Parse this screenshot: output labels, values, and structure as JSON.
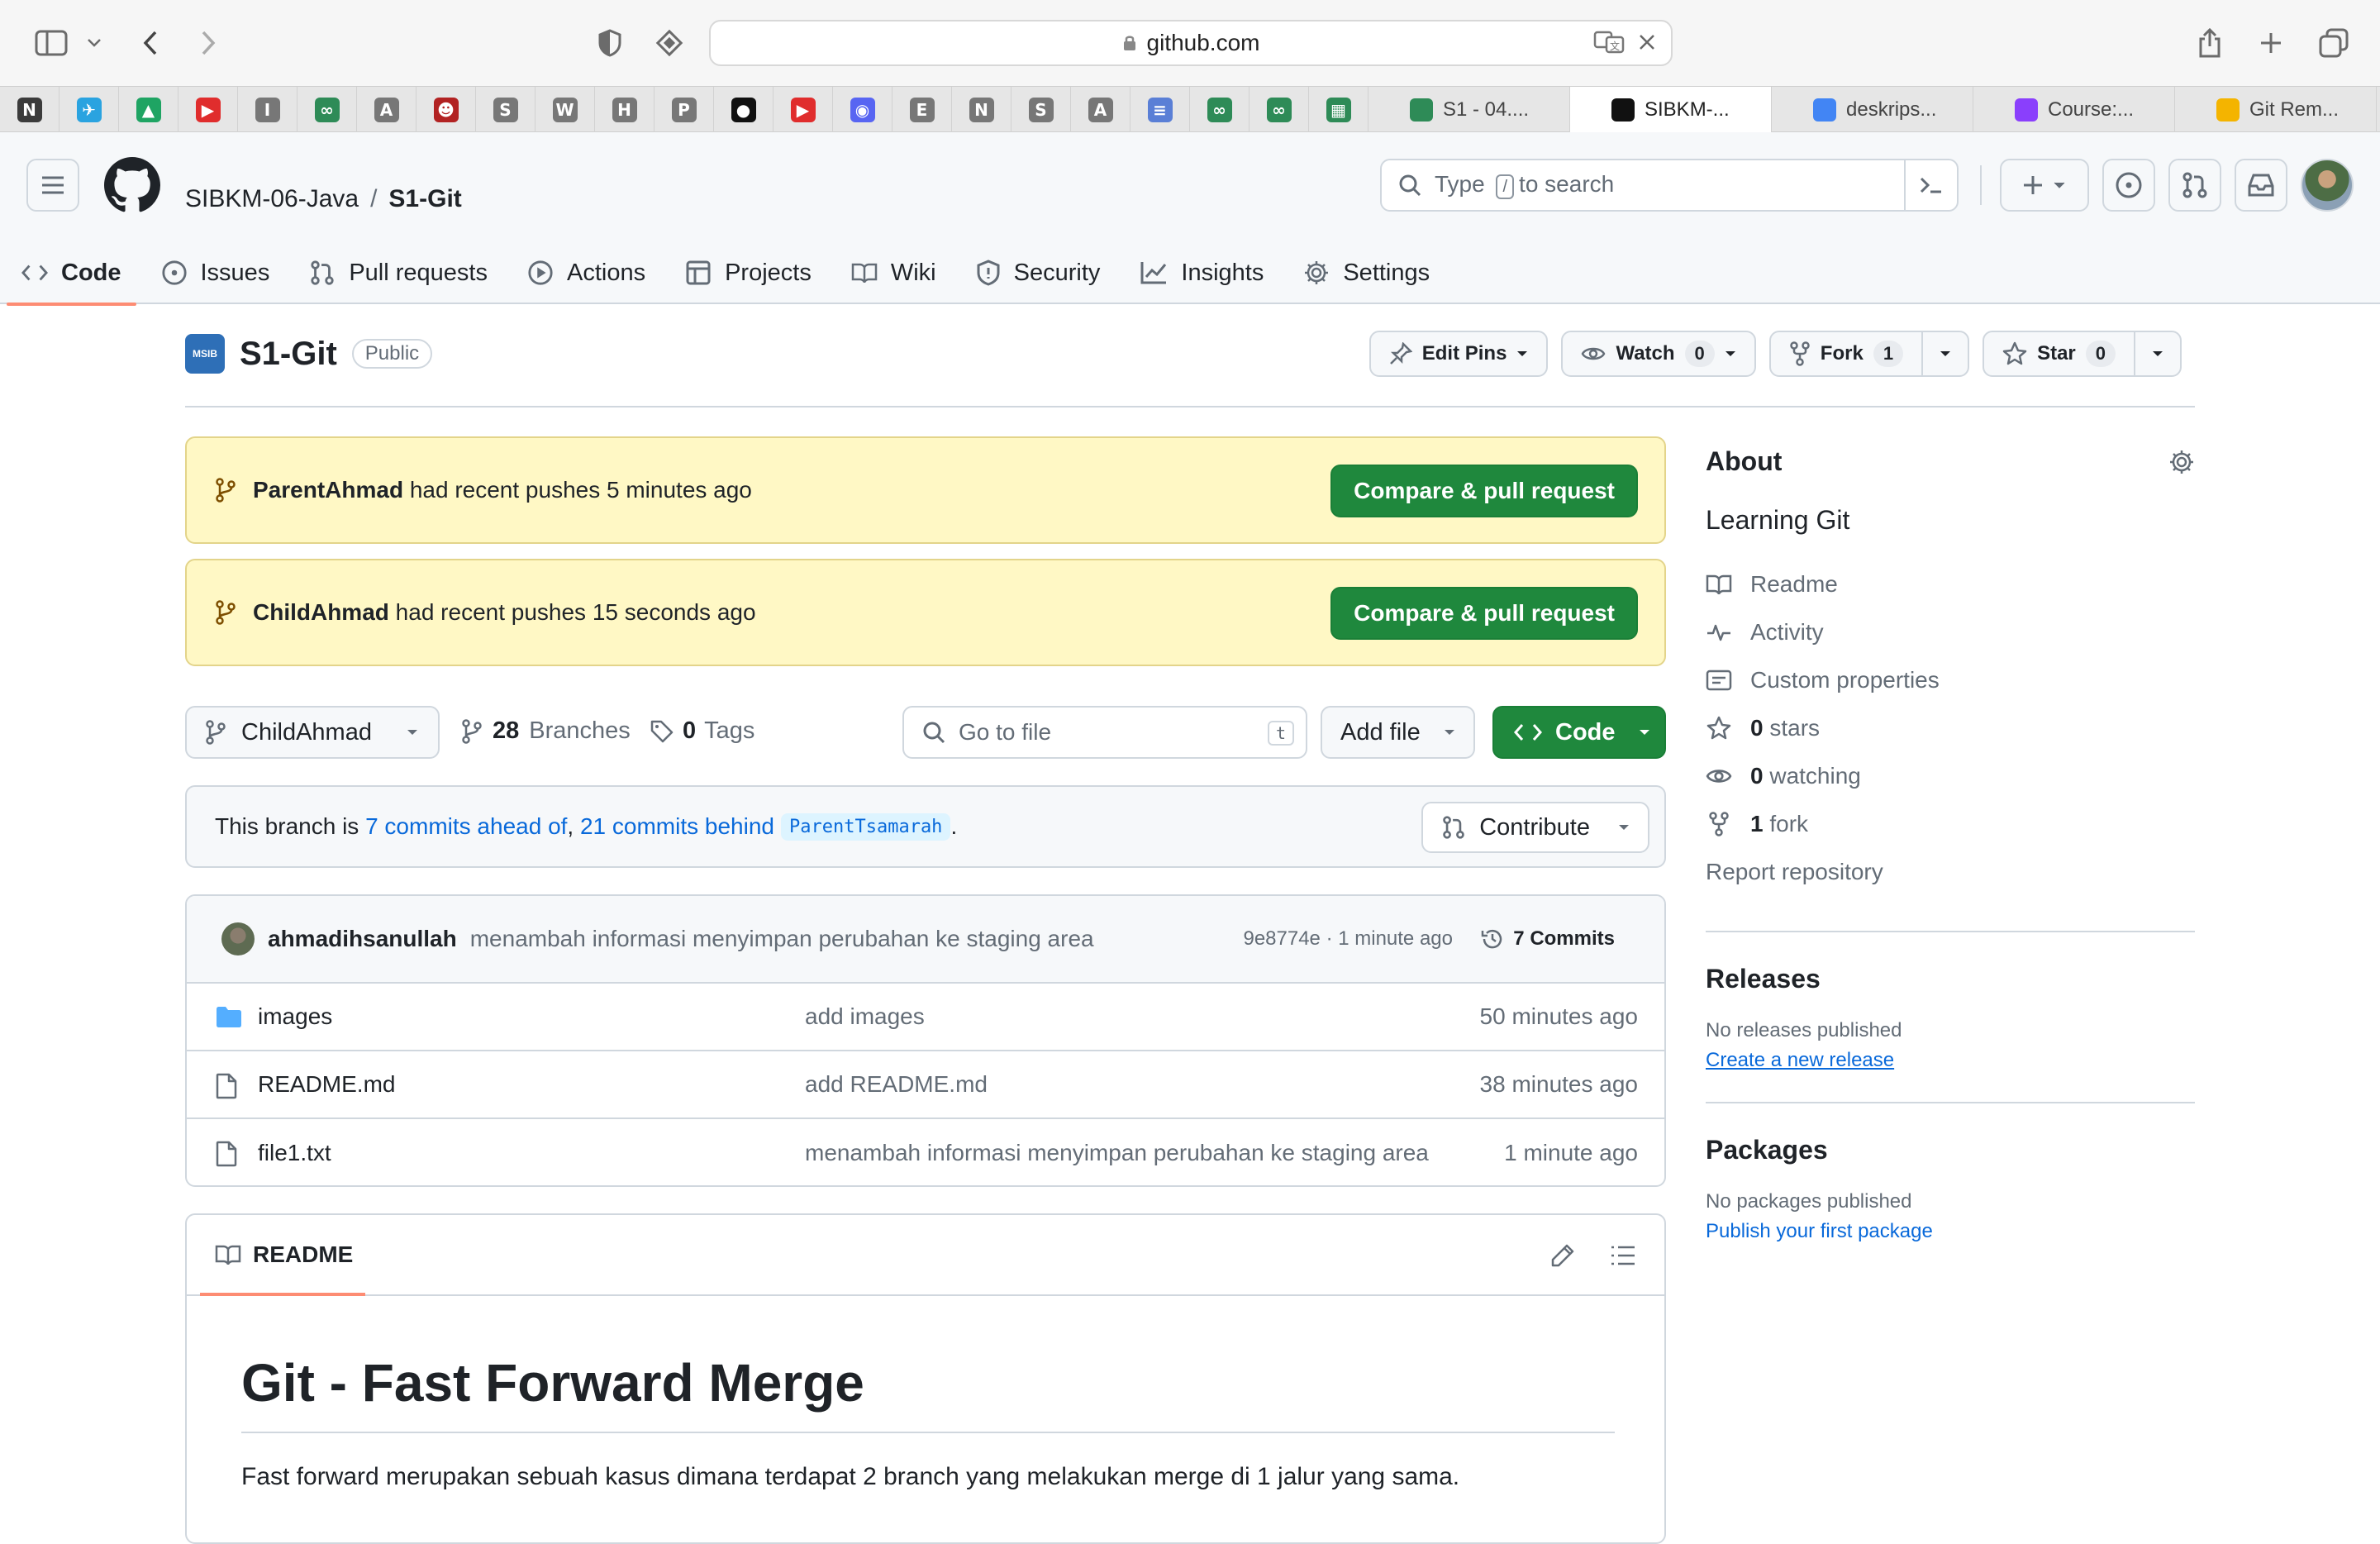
{
  "browser": {
    "url": "github.com",
    "pinned_tabs": [
      {
        "label": "N",
        "color": "#3b3b3b"
      },
      {
        "label": "✈",
        "color": "#2aa3e0"
      },
      {
        "label": "▲",
        "color": "#1fa463"
      },
      {
        "label": "▶",
        "color": "#e02d2d"
      },
      {
        "label": "I",
        "color": "#777777"
      },
      {
        "label": "∞",
        "color": "#2e8b57"
      },
      {
        "label": "A",
        "color": "#777777"
      },
      {
        "label": "☻",
        "color": "#b22222"
      },
      {
        "label": "S",
        "color": "#777777"
      },
      {
        "label": "W",
        "color": "#777777"
      },
      {
        "label": "H",
        "color": "#777777"
      },
      {
        "label": "P",
        "color": "#777777"
      },
      {
        "label": "●",
        "color": "#111111"
      },
      {
        "label": "▶",
        "color": "#e02d2d"
      },
      {
        "label": "◉",
        "color": "#5865f2"
      },
      {
        "label": "E",
        "color": "#777777"
      },
      {
        "label": "N",
        "color": "#777777"
      },
      {
        "label": "S",
        "color": "#777777"
      },
      {
        "label": "A",
        "color": "#777777"
      },
      {
        "label": "≡",
        "color": "#5a7fd6"
      },
      {
        "label": "∞",
        "color": "#2e8b57"
      },
      {
        "label": "∞",
        "color": "#2e8b57"
      },
      {
        "label": "▦",
        "color": "#2e8b57"
      }
    ],
    "tabs": [
      {
        "label": "S1 - 04....",
        "color": "#2e8b57",
        "active": false
      },
      {
        "label": "SIBKM-...",
        "color": "#111111",
        "active": true
      },
      {
        "label": "deskrips...",
        "color": "#4285f4",
        "active": false
      },
      {
        "label": "Course:...",
        "color": "#8a3ffc",
        "active": false
      },
      {
        "label": "Git Rem...",
        "color": "#f4b400",
        "active": false
      }
    ]
  },
  "header": {
    "owner": "SIBKM-06-Java",
    "separator": "/",
    "repo": "S1-Git",
    "search_prefix": "Type",
    "search_key": "/",
    "search_suffix": "to search"
  },
  "nav": [
    {
      "label": "Code",
      "icon": "code-icon",
      "active": true
    },
    {
      "label": "Issues",
      "icon": "issue-icon",
      "active": false
    },
    {
      "label": "Pull requests",
      "icon": "pull-request-icon",
      "active": false
    },
    {
      "label": "Actions",
      "icon": "play-icon",
      "active": false
    },
    {
      "label": "Projects",
      "icon": "table-icon",
      "active": false
    },
    {
      "label": "Wiki",
      "icon": "book-icon",
      "active": false
    },
    {
      "label": "Security",
      "icon": "shield-icon",
      "active": false
    },
    {
      "label": "Insights",
      "icon": "graph-icon",
      "active": false
    },
    {
      "label": "Settings",
      "icon": "gear-icon",
      "active": false
    }
  ],
  "repo": {
    "logo_text": "MSIB",
    "name": "S1-Git",
    "visibility": "Public",
    "edit_pins": "Edit Pins",
    "watch_label": "Watch",
    "watch_count": "0",
    "fork_label": "Fork",
    "fork_count": "1",
    "star_label": "Star",
    "star_count": "0"
  },
  "banners": [
    {
      "user": "ParentAhmad",
      "text": "had recent pushes 5 minutes ago",
      "button": "Compare & pull request"
    },
    {
      "user": "ChildAhmad",
      "text": "had recent pushes 15 seconds ago",
      "button": "Compare & pull request"
    }
  ],
  "branch": {
    "current": "ChildAhmad",
    "branches_count": "28",
    "branches_label": "Branches",
    "tags_count": "0",
    "tags_label": "Tags",
    "goto_placeholder": "Go to file",
    "goto_key": "t",
    "add_file": "Add file",
    "code": "Code"
  },
  "ahead": {
    "prefix": "This branch is",
    "ahead_link": "7 commits ahead of",
    "comma": ",",
    "behind_link": "21 commits behind",
    "base": "ParentTsamarah",
    "suffix": ".",
    "contribute": "Contribute"
  },
  "latest_commit": {
    "author": "ahmadihsanullah",
    "message": "menambah informasi menyimpan perubahan ke staging area",
    "meta": "9e8774e · 1 minute ago",
    "commits": "7 Commits"
  },
  "files": [
    {
      "name": "images",
      "type": "folder",
      "message": "add images",
      "age": "50 minutes ago"
    },
    {
      "name": "README.md",
      "type": "file",
      "message": "add README.md",
      "age": "38 minutes ago"
    },
    {
      "name": "file1.txt",
      "type": "file",
      "message": "menambah informasi menyimpan perubahan ke staging area",
      "age": "1 minute ago"
    }
  ],
  "readme": {
    "tab": "README",
    "heading": "Git - Fast Forward Merge",
    "paragraph": "Fast forward merupakan sebuah kasus dimana terdapat 2 branch yang melakukan merge di 1 jalur yang sama."
  },
  "sidebar": {
    "about": "About",
    "description": "Learning Git",
    "readme": "Readme",
    "activity": "Activity",
    "custom_properties": "Custom properties",
    "stars_count": "0",
    "stars_label": "stars",
    "watching_count": "0",
    "watching_label": "watching",
    "fork_count": "1",
    "fork_label": "fork",
    "report": "Report repository",
    "releases": "Releases",
    "no_releases": "No releases published",
    "create_release": "Create a new release",
    "packages": "Packages",
    "no_packages": "No packages published",
    "publish_package": "Publish your first package"
  },
  "colors": {
    "accent_green": "#1f883d",
    "link_blue": "#0969da",
    "banner_yellow": "#fff8c5",
    "nav_underline": "#fd8c73"
  }
}
